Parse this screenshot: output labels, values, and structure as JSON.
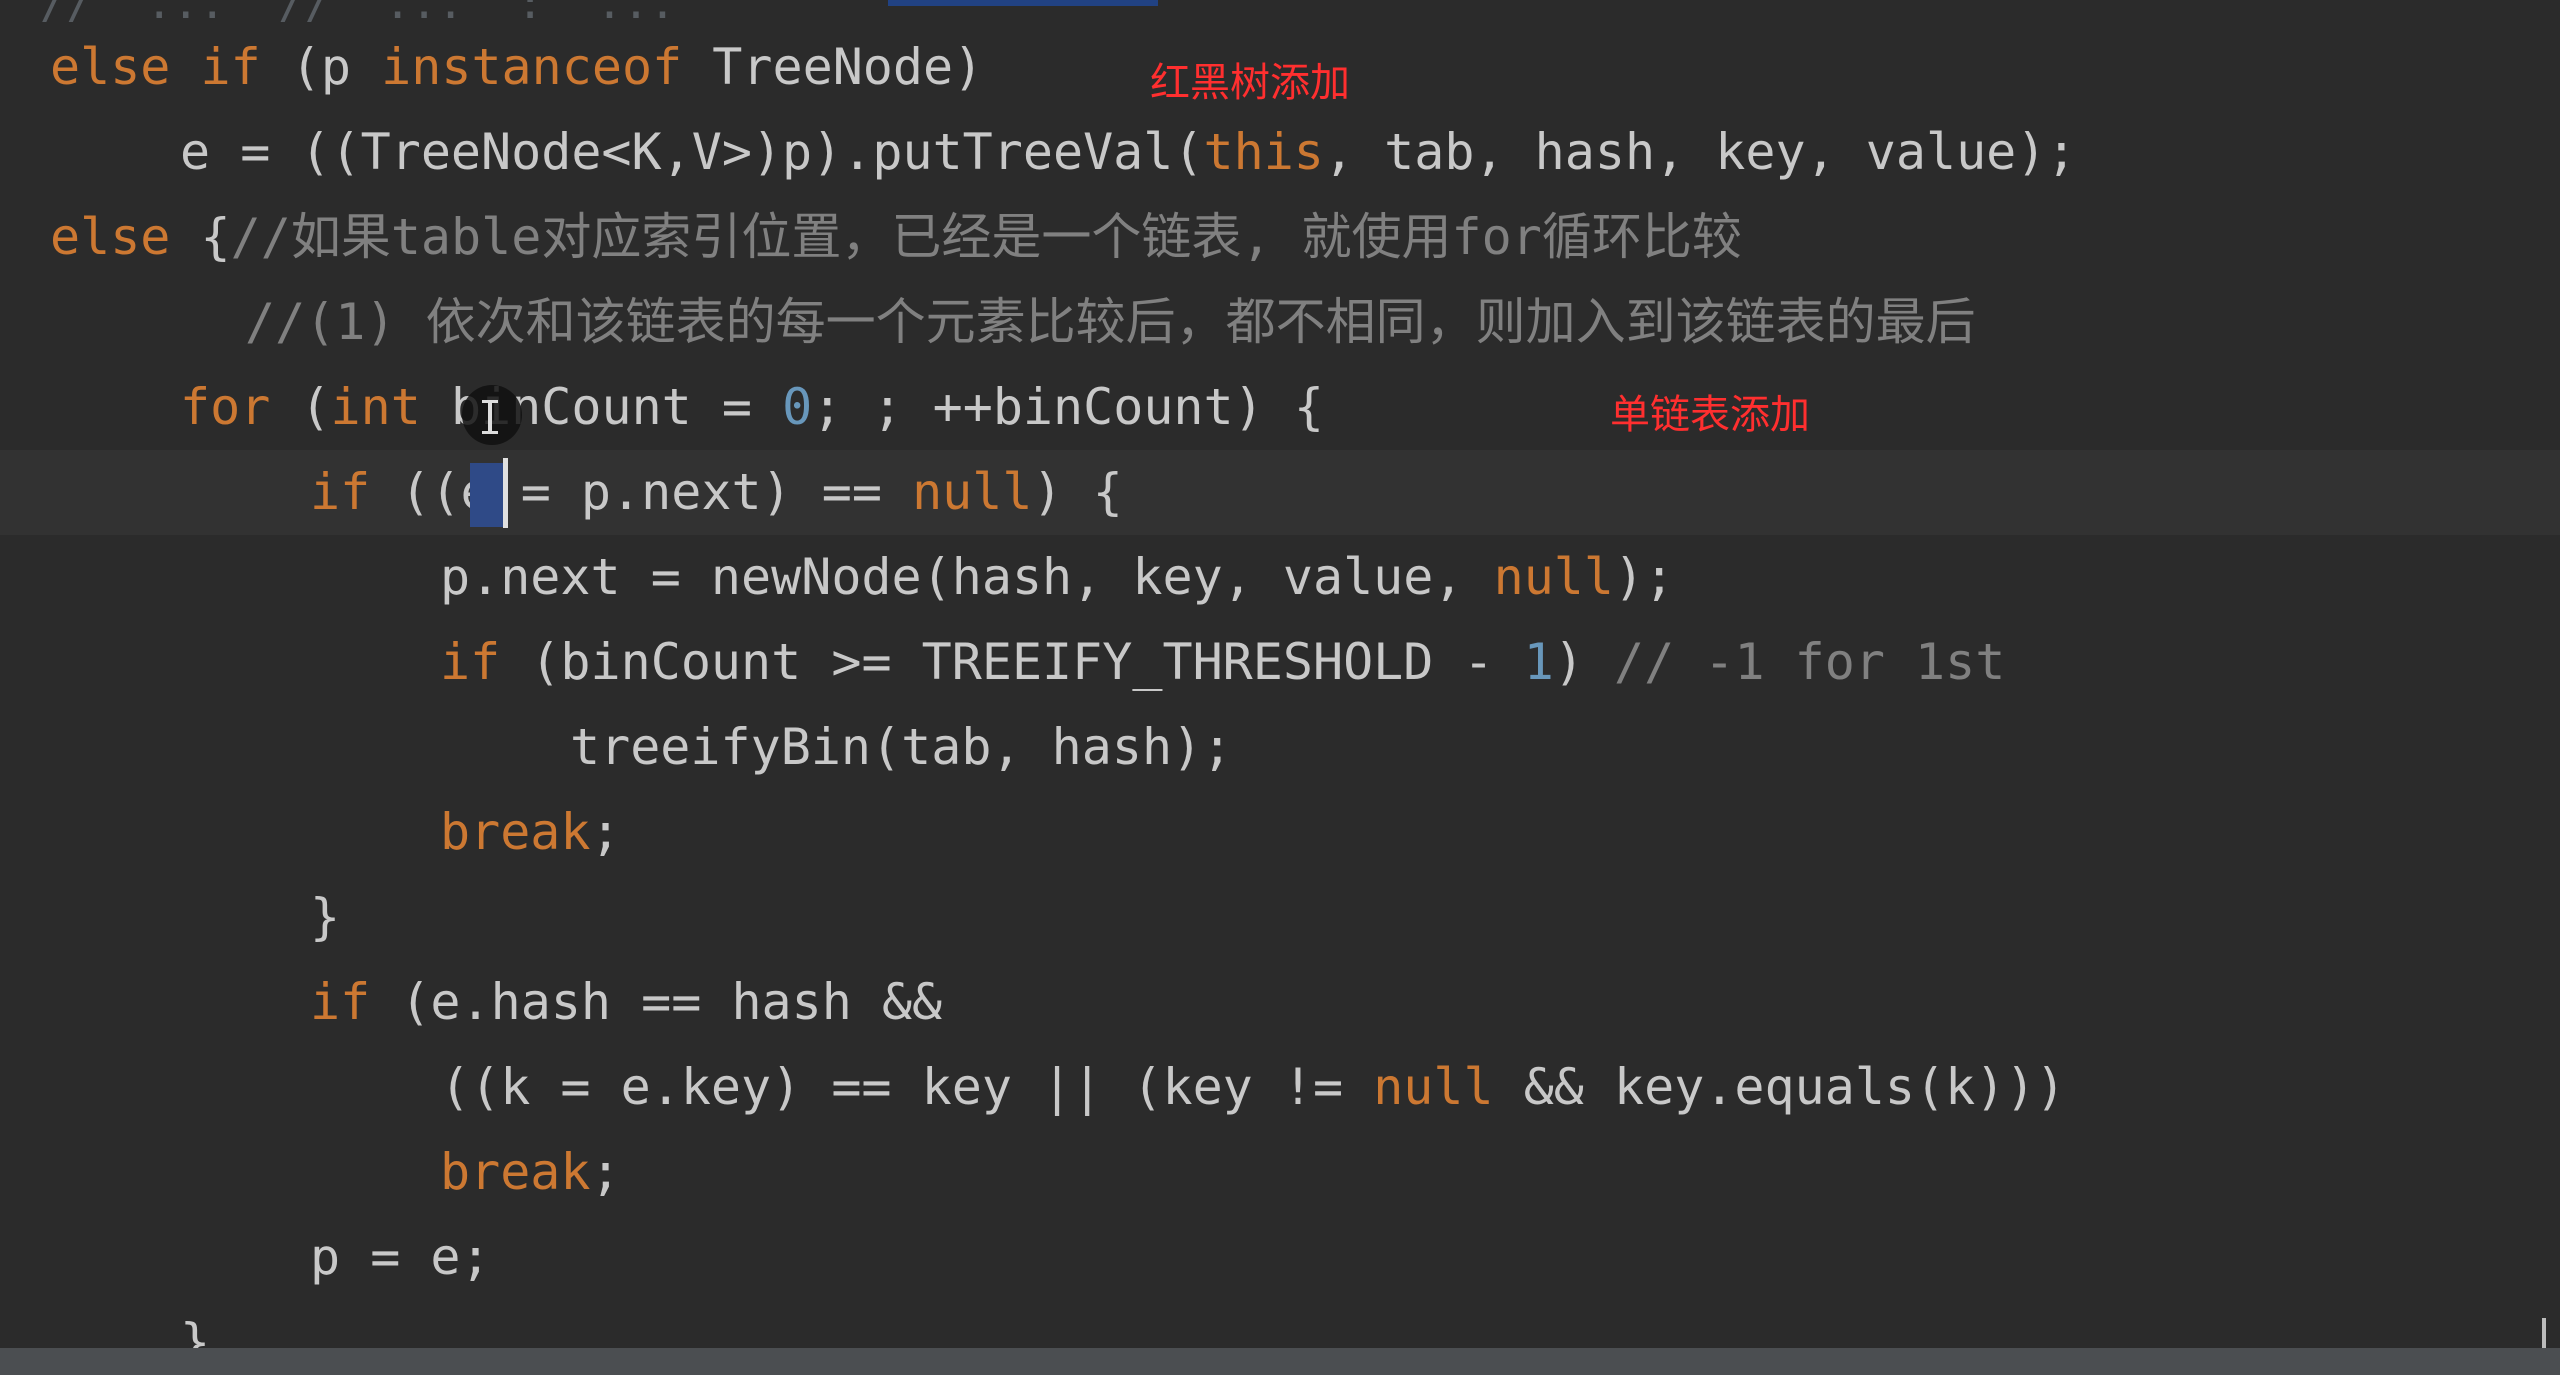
{
  "editor": {
    "top_clipped_line": "//  ...  //  ...  :  ...",
    "lines": [
      {
        "indent": 0,
        "segments": [
          {
            "t": "kw",
            "v": "else if "
          },
          {
            "t": "plain",
            "v": "(p "
          },
          {
            "t": "kw",
            "v": "instanceof "
          },
          {
            "t": "plain",
            "v": "TreeNode)"
          }
        ]
      },
      {
        "indent": 1,
        "segments": [
          {
            "t": "plain",
            "v": "e = ((TreeNode<K,V>)p).putTreeVal("
          },
          {
            "t": "kw",
            "v": "this"
          },
          {
            "t": "plain",
            "v": ", tab, hash, key, value);"
          }
        ]
      },
      {
        "indent": 0,
        "segments": [
          {
            "t": "kw",
            "v": "else "
          },
          {
            "t": "plain",
            "v": "{"
          },
          {
            "t": "cmt",
            "v": "//如果table对应索引位置，已经是一个链表, 就使用for循环比较"
          }
        ]
      },
      {
        "indent": 1.5,
        "segments": [
          {
            "t": "cmt",
            "v": "//(1) 依次和该链表的每一个元素比较后，都不相同，则加入到该链表的最后"
          }
        ]
      },
      {
        "indent": 1,
        "segments": [
          {
            "t": "kw",
            "v": "for "
          },
          {
            "t": "plain",
            "v": "("
          },
          {
            "t": "kw",
            "v": "int "
          },
          {
            "t": "plain",
            "v": "binCount = "
          },
          {
            "t": "num",
            "v": "0"
          },
          {
            "t": "plain",
            "v": "; ; ++binCount) {"
          }
        ]
      },
      {
        "indent": 2,
        "current": true,
        "segments": [
          {
            "t": "kw",
            "v": "if "
          },
          {
            "t": "plain",
            "v": "((e = p.next) == "
          },
          {
            "t": "kw",
            "v": "null"
          },
          {
            "t": "plain",
            "v": ") {"
          }
        ]
      },
      {
        "indent": 3,
        "segments": [
          {
            "t": "plain",
            "v": "p.next = newNode(hash, key, value, "
          },
          {
            "t": "kw",
            "v": "null"
          },
          {
            "t": "plain",
            "v": ");"
          }
        ]
      },
      {
        "indent": 3,
        "segments": [
          {
            "t": "kw",
            "v": "if "
          },
          {
            "t": "plain",
            "v": "(binCount >= TREEIFY_THRESHOLD - "
          },
          {
            "t": "num",
            "v": "1"
          },
          {
            "t": "plain",
            "v": ") "
          },
          {
            "t": "cmt",
            "v": "// -1 for 1st"
          }
        ]
      },
      {
        "indent": 4,
        "segments": [
          {
            "t": "plain",
            "v": "treeifyBin(tab, hash);"
          }
        ]
      },
      {
        "indent": 3,
        "segments": [
          {
            "t": "kw",
            "v": "break"
          },
          {
            "t": "plain",
            "v": ";"
          }
        ]
      },
      {
        "indent": 2,
        "segments": [
          {
            "t": "plain",
            "v": "}"
          }
        ]
      },
      {
        "indent": 2,
        "segments": [
          {
            "t": "kw",
            "v": "if "
          },
          {
            "t": "plain",
            "v": "(e.hash == hash &&"
          }
        ]
      },
      {
        "indent": 3,
        "segments": [
          {
            "t": "plain",
            "v": "((k = e.key) == key || (key != "
          },
          {
            "t": "kw",
            "v": "null "
          },
          {
            "t": "plain",
            "v": "&& key.equals(k)))"
          }
        ]
      },
      {
        "indent": 3,
        "segments": [
          {
            "t": "kw",
            "v": "break"
          },
          {
            "t": "plain",
            "v": ";"
          }
        ]
      },
      {
        "indent": 2,
        "segments": [
          {
            "t": "plain",
            "v": "p = e;"
          }
        ]
      },
      {
        "indent": 1,
        "segments": [
          {
            "t": "plain",
            "v": "}"
          }
        ]
      }
    ]
  },
  "annotations": {
    "red_black_tree_add": "红黑树添加",
    "singly_linked_list_add": "单链表添加"
  },
  "colors": {
    "background": "#2b2b2b",
    "current_line": "#323232",
    "keyword": "#cc7832",
    "number": "#6897bb",
    "comment": "#808080",
    "text": "#c8c8c8",
    "annotation": "#ff2f2f",
    "selection": "#2f4a87"
  }
}
